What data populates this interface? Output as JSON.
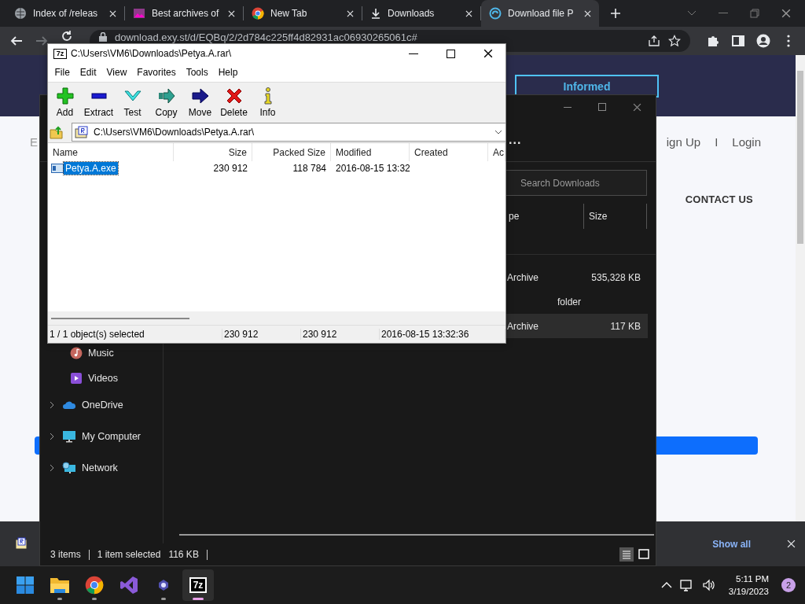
{
  "browser": {
    "tabs": [
      {
        "title": "Index of /releas",
        "kind": "globe",
        "selected": false
      },
      {
        "title": "Best archives of",
        "kind": "image",
        "selected": false
      },
      {
        "title": "New Tab",
        "kind": "chrome",
        "selected": false
      },
      {
        "title": "Downloads",
        "kind": "download",
        "selected": false
      },
      {
        "title": "Download file P",
        "kind": "site",
        "selected": true
      }
    ],
    "url": "download.exy.st/d/EQBq/2/2d784c225ff4d82931ac06930265061c#"
  },
  "web_page": {
    "header_button": "Informed",
    "side_letter": "E",
    "nav_links": [
      "ign Up",
      "I",
      "Login"
    ],
    "contact": "CONTACT US"
  },
  "downloads_bar": {
    "show_all": "Show all"
  },
  "explorer": {
    "more": "...",
    "search_placeholder": "Search Downloads",
    "columns": [
      "pe",
      "Size"
    ],
    "rows": [
      {
        "type": "Archive",
        "size": "535,328 KB",
        "selected": false
      },
      {
        "type": "folder",
        "selected": false
      },
      {
        "type": "Archive",
        "size": "117 KB",
        "selected": true
      }
    ],
    "nav": [
      {
        "label": "Music",
        "kind": "music",
        "expandable": false
      },
      {
        "label": "Videos",
        "kind": "video",
        "expandable": false
      },
      {
        "label": "OneDrive",
        "kind": "cloud",
        "expandable": true
      },
      {
        "label": "My Computer",
        "kind": "computer",
        "expandable": true
      },
      {
        "label": "Network",
        "kind": "network",
        "expandable": true
      }
    ],
    "status": [
      "3 items",
      "1 item selected",
      "116 KB"
    ]
  },
  "sevenzip": {
    "icon_text": "7z",
    "title": "C:\\Users\\VM6\\Downloads\\Petya.A.rar\\",
    "menu": [
      "File",
      "Edit",
      "View",
      "Favorites",
      "Tools",
      "Help"
    ],
    "toolbar": [
      {
        "label": "Add",
        "kind": "add"
      },
      {
        "label": "Extract",
        "kind": "extract"
      },
      {
        "label": "Test",
        "kind": "test"
      },
      {
        "label": "Copy",
        "kind": "copy"
      },
      {
        "label": "Move",
        "kind": "move"
      },
      {
        "label": "Delete",
        "kind": "delete"
      },
      {
        "label": "Info",
        "kind": "info"
      }
    ],
    "path": "C:\\Users\\VM6\\Downloads\\Petya.A.rar\\",
    "columns": [
      "Name",
      "Size",
      "Packed Size",
      "Modified",
      "Created",
      "Ac"
    ],
    "rows": [
      {
        "name": "Petya.A.exe",
        "size": "230 912",
        "packed_size": "118 784",
        "modified": "2016-08-15 13:32",
        "selected": true
      }
    ],
    "status": [
      "1 / 1 object(s) selected",
      "230 912",
      "230 912",
      "2016-08-15 13:32:36"
    ]
  },
  "taskbar": {
    "apps": [
      {
        "kind": "start",
        "running": false,
        "selected": false
      },
      {
        "kind": "files",
        "running": true,
        "selected": false
      },
      {
        "kind": "chrome",
        "running": true,
        "selected": false
      },
      {
        "kind": "studio",
        "running": false,
        "selected": false
      },
      {
        "kind": "app",
        "running": true,
        "selected": false
      },
      {
        "kind": "archiver",
        "label": "7z",
        "running": true,
        "selected": true
      }
    ],
    "time": "5:11 PM",
    "date": "3/19/2023",
    "badge": "2"
  }
}
